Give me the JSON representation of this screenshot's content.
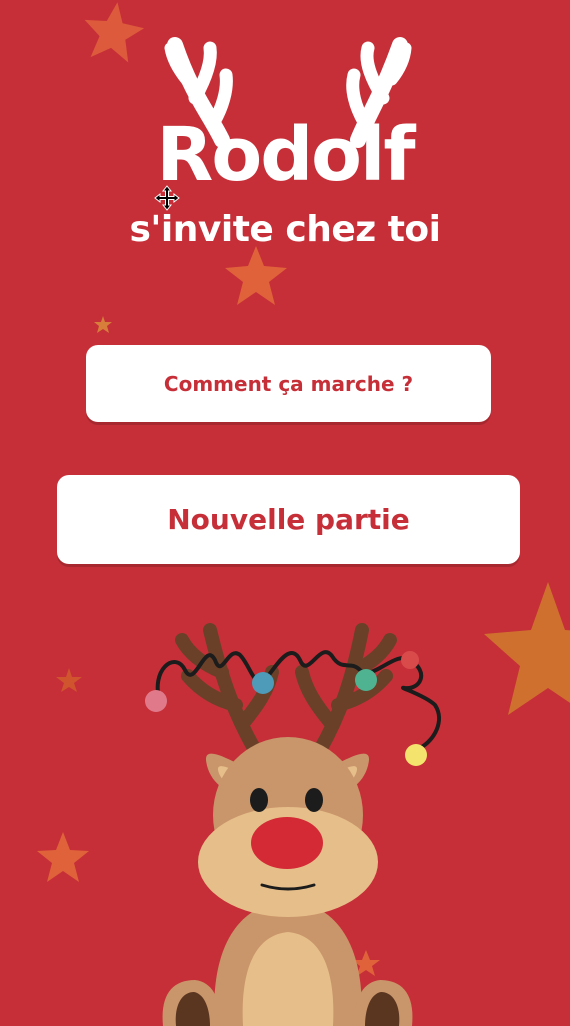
{
  "logo": {
    "title": "Rodolf",
    "subtitle": "s'invite chez toi"
  },
  "buttons": {
    "how_it_works": "Comment ça marche ?",
    "new_game": "Nouvelle partie"
  },
  "colors": {
    "background": "#c62f38",
    "button_bg": "#ffffff",
    "button_text": "#c62f38",
    "star": "#e0623a",
    "star_large": "#d0702e",
    "reindeer_fur": "#c9956a",
    "reindeer_muzzle": "#e6be8a",
    "reindeer_nose": "#d42a35",
    "antler": "#6a4128"
  },
  "icons": {
    "cursor": "move-cursor-icon"
  }
}
